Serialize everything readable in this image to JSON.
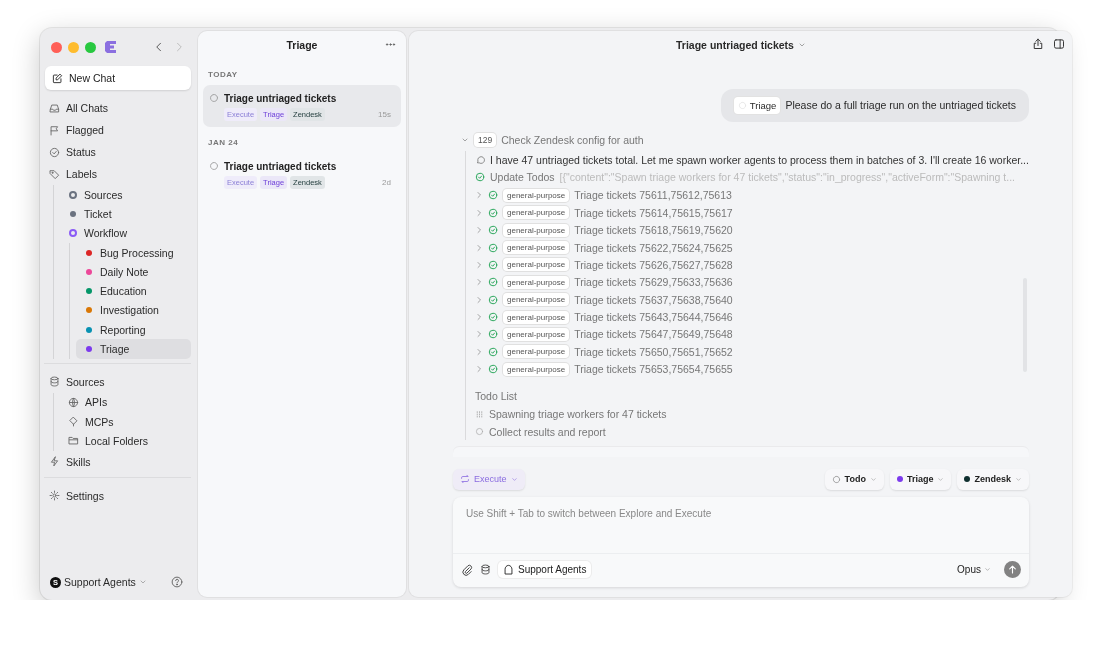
{
  "sidebar": {
    "new_chat": "New Chat",
    "sections": [
      {
        "items": [
          {
            "label": "All Chats",
            "selected": false
          },
          {
            "label": "Flagged",
            "selected": false
          },
          {
            "label": "Status",
            "selected": false
          },
          {
            "label": "Labels",
            "selected": false,
            "children": [
              {
                "label": "Sources",
                "kind": "ring",
                "color": "#6b7280",
                "selected": false
              },
              {
                "label": "Ticket",
                "kind": "dot",
                "color": "#6b7280",
                "selected": false
              },
              {
                "label": "Workflow",
                "kind": "ring",
                "color": "#8b5cf6",
                "selected": false,
                "children": [
                  {
                    "label": "Bug Processing",
                    "kind": "dot",
                    "color": "#dc2626",
                    "selected": false
                  },
                  {
                    "label": "Daily Note",
                    "kind": "dot",
                    "color": "#ec4899",
                    "selected": false
                  },
                  {
                    "label": "Education",
                    "kind": "dot",
                    "color": "#059669",
                    "selected": false
                  },
                  {
                    "label": "Investigation",
                    "kind": "dot",
                    "color": "#d97706",
                    "selected": false
                  },
                  {
                    "label": "Reporting",
                    "kind": "dot",
                    "color": "#0891b2",
                    "selected": false
                  },
                  {
                    "label": "Triage",
                    "kind": "dot",
                    "color": "#7c3aed",
                    "selected": true
                  }
                ]
              }
            ]
          }
        ]
      },
      {
        "items": [
          {
            "label": "Sources",
            "selected": false,
            "children": [
              {
                "label": "APIs",
                "selected": false
              },
              {
                "label": "MCPs",
                "selected": false
              },
              {
                "label": "Local Folders",
                "selected": false
              }
            ]
          },
          {
            "label": "Skills",
            "selected": false
          }
        ]
      },
      {
        "items": [
          {
            "label": "Settings",
            "selected": false
          }
        ]
      }
    ],
    "workspace": {
      "avatar": "S",
      "name": "Support Agents"
    }
  },
  "chat_list": {
    "title": "Triage",
    "groups": [
      {
        "heading": "TODAY",
        "chats": [
          {
            "title": "Triage untriaged tickets",
            "time": "15s",
            "selected": true,
            "tags": [
              {
                "label": "Execute",
                "kind": "mode"
              },
              {
                "label": "Triage",
                "kind": "label"
              },
              {
                "label": "Zendesk",
                "kind": "source"
              }
            ]
          }
        ]
      },
      {
        "heading": "JAN 24",
        "chats": [
          {
            "title": "Triage untriaged tickets",
            "time": "2d",
            "selected": false,
            "tags": [
              {
                "label": "Execute",
                "kind": "mode"
              },
              {
                "label": "Triage",
                "kind": "label"
              },
              {
                "label": "Zendesk",
                "kind": "source"
              }
            ]
          }
        ]
      }
    ]
  },
  "chat": {
    "title": "Triage untriaged tickets",
    "user_message": {
      "chip": "Triage",
      "text": "Please do a full triage run on the untriaged tickets"
    },
    "tool_group": {
      "count": "129",
      "title": "Check Zendesk config for auth",
      "expanded": true,
      "steps": [
        {
          "kind": "thought",
          "text": "I have 47 untriaged tickets total. Let me spawn worker agents to process them in batches of 3. I'll create 16 worker..."
        },
        {
          "kind": "tool",
          "name": "Update Todos",
          "detail": "[{\"content\":\"Spawn triage workers for 47 tickets\",\"status\":\"in_progress\",\"activeForm\":\"Spawning t..."
        }
      ],
      "tasks": [
        {
          "badge": "general-purpose",
          "text": "Triage tickets 75611,75612,75613",
          "expanded": false
        },
        {
          "badge": "general-purpose",
          "text": "Triage tickets 75614,75615,75617",
          "expanded": false
        },
        {
          "badge": "general-purpose",
          "text": "Triage tickets 75618,75619,75620",
          "expanded": false
        },
        {
          "badge": "general-purpose",
          "text": "Triage tickets 75622,75624,75625",
          "expanded": false
        },
        {
          "badge": "general-purpose",
          "text": "Triage tickets 75626,75627,75628",
          "expanded": false
        },
        {
          "badge": "general-purpose",
          "text": "Triage tickets 75629,75633,75636",
          "expanded": false
        },
        {
          "badge": "general-purpose",
          "text": "Triage tickets 75637,75638,75640",
          "expanded": false
        },
        {
          "badge": "general-purpose",
          "text": "Triage tickets 75643,75644,75646",
          "expanded": false
        },
        {
          "badge": "general-purpose",
          "text": "Triage tickets 75647,75649,75648",
          "expanded": false
        },
        {
          "badge": "general-purpose",
          "text": "Triage tickets 75650,75651,75652",
          "expanded": false
        },
        {
          "badge": "general-purpose",
          "text": "Triage tickets 75653,75654,75655",
          "expanded": false
        }
      ],
      "todo": {
        "heading": "Todo List",
        "items": [
          {
            "text": "Spawning triage workers for 47 tickets",
            "kind": "in_progress"
          },
          {
            "text": "Collect results and report",
            "kind": "pending"
          }
        ]
      }
    },
    "composer": {
      "mode": "Execute",
      "chips": [
        {
          "label": "Todo",
          "kind": "status"
        },
        {
          "label": "Triage",
          "kind": "label",
          "color": "#7c3aed"
        },
        {
          "label": "Zendesk",
          "kind": "label",
          "color": "#0f2f2f"
        }
      ],
      "placeholder": "Use Shift + Tab to switch between Explore and Execute",
      "workspace": "Support Agents",
      "model": "Opus"
    }
  }
}
